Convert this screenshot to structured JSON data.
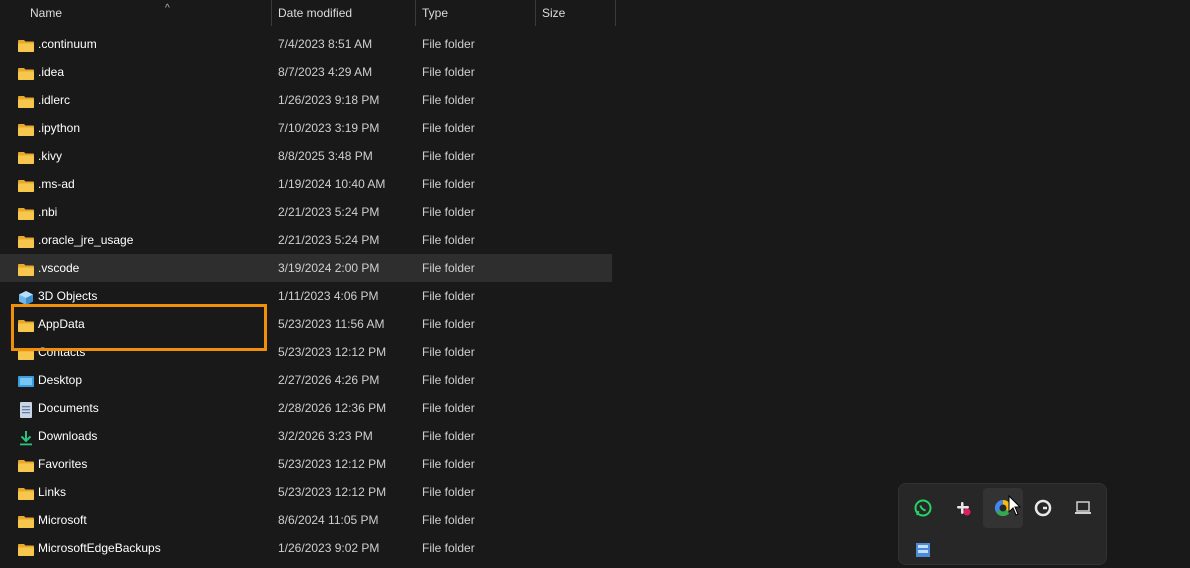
{
  "columns": {
    "name": "Name",
    "date": "Date modified",
    "type": "Type",
    "size": "Size"
  },
  "files": [
    {
      "name": ".continuum",
      "date": "7/4/2023 8:51 AM",
      "type": "File folder",
      "icon": "folder-icon"
    },
    {
      "name": ".idea",
      "date": "8/7/2023 4:29 AM",
      "type": "File folder",
      "icon": "folder-icon"
    },
    {
      "name": ".idlerc",
      "date": "1/26/2023 9:18 PM",
      "type": "File folder",
      "icon": "folder-icon"
    },
    {
      "name": ".ipython",
      "date": "7/10/2023 3:19 PM",
      "type": "File folder",
      "icon": "folder-icon"
    },
    {
      "name": ".kivy",
      "date": "8/8/2025 3:48 PM",
      "type": "File folder",
      "icon": "folder-icon"
    },
    {
      "name": ".ms-ad",
      "date": "1/19/2024 10:40 AM",
      "type": "File folder",
      "icon": "folder-icon"
    },
    {
      "name": ".nbi",
      "date": "2/21/2023 5:24 PM",
      "type": "File folder",
      "icon": "folder-icon"
    },
    {
      "name": ".oracle_jre_usage",
      "date": "2/21/2023 5:24 PM",
      "type": "File folder",
      "icon": "folder-icon"
    },
    {
      "name": ".vscode",
      "date": "3/19/2024 2:00 PM",
      "type": "File folder",
      "icon": "folder-icon"
    },
    {
      "name": "3D Objects",
      "date": "1/11/2023 4:06 PM",
      "type": "File folder",
      "icon": "3d-objects-icon"
    },
    {
      "name": "AppData",
      "date": "5/23/2023 11:56 AM",
      "type": "File folder",
      "icon": "folder-icon"
    },
    {
      "name": "Contacts",
      "date": "5/23/2023 12:12 PM",
      "type": "File folder",
      "icon": "folder-icon"
    },
    {
      "name": "Desktop",
      "date": "2/27/2026 4:26 PM",
      "type": "File folder",
      "icon": "desktop-icon"
    },
    {
      "name": "Documents",
      "date": "2/28/2026 12:36 PM",
      "type": "File folder",
      "icon": "documents-icon"
    },
    {
      "name": "Downloads",
      "date": "3/2/2026 3:23 PM",
      "type": "File folder",
      "icon": "downloads-icon"
    },
    {
      "name": "Favorites",
      "date": "5/23/2023 12:12 PM",
      "type": "File folder",
      "icon": "folder-icon"
    },
    {
      "name": "Links",
      "date": "5/23/2023 12:12 PM",
      "type": "File folder",
      "icon": "folder-icon"
    },
    {
      "name": "Microsoft",
      "date": "8/6/2024 11:05 PM",
      "type": "File folder",
      "icon": "folder-icon"
    },
    {
      "name": "MicrosoftEdgeBackups",
      "date": "1/26/2023 9:02 PM",
      "type": "File folder",
      "icon": "folder-icon"
    }
  ],
  "selected_index": 8,
  "highlight_color": "#f0900a",
  "tray_icons": [
    "whatsapp-icon",
    "slack-icon",
    "chrome-colored-icon",
    "grammarly-icon",
    "laptop-icon",
    "network-device-icon"
  ]
}
